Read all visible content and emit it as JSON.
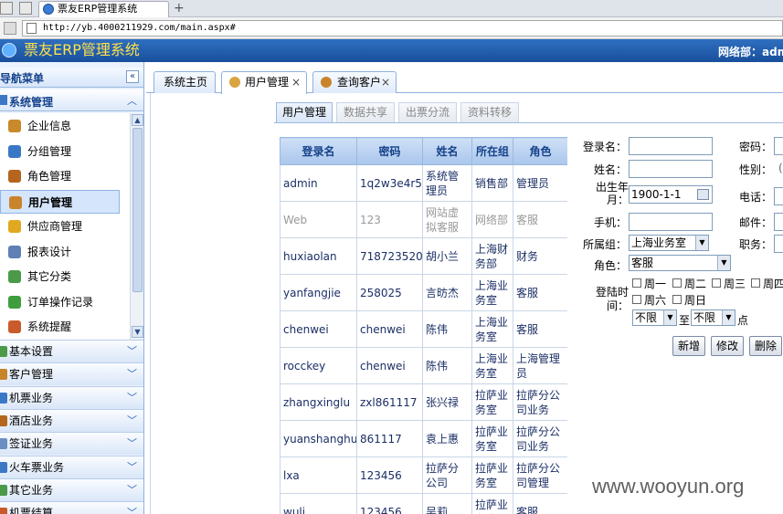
{
  "browser": {
    "tab_title": "票友ERP管理系统",
    "new_tab": "+",
    "url": "http://yb.4000211929.com/main.aspx#"
  },
  "header": {
    "app_title": "票友ERP管理系统",
    "user_info": "网络部：adm"
  },
  "sidebar": {
    "title": "导航菜单",
    "collapse": "«",
    "section_system": "系统管理",
    "items": [
      {
        "label": "企业信息",
        "icon": "building-icon",
        "color": "#c98a2b"
      },
      {
        "label": "分组管理",
        "icon": "org-chart-icon",
        "color": "#3a78c6"
      },
      {
        "label": "角色管理",
        "icon": "role-icon",
        "color": "#b5651d"
      },
      {
        "label": "用户管理",
        "icon": "users-icon",
        "color": "#c9842b"
      },
      {
        "label": "供应商管理",
        "icon": "shield-icon",
        "color": "#e0a91f"
      },
      {
        "label": "报表设计",
        "icon": "report-icon",
        "color": "#5f7fb5"
      },
      {
        "label": "其它分类",
        "icon": "category-icon",
        "color": "#4a9a4a"
      },
      {
        "label": "订单操作记录",
        "icon": "check-icon",
        "color": "#3e9e3e"
      },
      {
        "label": "系统提醒",
        "icon": "bell-icon",
        "color": "#c95b2b"
      }
    ],
    "active_index": 3,
    "sections": [
      {
        "label": "基本设置",
        "color": "#4a9a4a"
      },
      {
        "label": "客户管理",
        "color": "#c9842b"
      },
      {
        "label": "机票业务",
        "color": "#3a78c6"
      },
      {
        "label": "酒店业务",
        "color": "#b5651d"
      },
      {
        "label": "签证业务",
        "color": "#6a8fc2"
      },
      {
        "label": "火车票业务",
        "color": "#3a78c6"
      },
      {
        "label": "其它业务",
        "color": "#4a9a4a"
      },
      {
        "label": "机票结算",
        "color": "#c95b2b"
      }
    ]
  },
  "content_tabs": [
    {
      "label": "系统主页",
      "closable": false
    },
    {
      "label": "用户管理",
      "closable": true,
      "close": "×"
    },
    {
      "label": "查询客户",
      "closable": true,
      "close": "×"
    }
  ],
  "inner_tabs": [
    "用户管理",
    "数据共享",
    "出票分流",
    "资料转移"
  ],
  "table": {
    "headers": [
      "登录名",
      "密码",
      "姓名",
      "所在组",
      "角色"
    ],
    "rows": [
      {
        "login": "admin",
        "password": "1q2w3e4r5t",
        "name": "系统管理员",
        "group": "销售部",
        "role": "管理员",
        "disabled": false
      },
      {
        "login": "Web",
        "password": "123",
        "name": "网站虚拟客服",
        "group": "网络部",
        "role": "客服",
        "disabled": true
      },
      {
        "login": "huxiaolan",
        "password": "718723520",
        "name": "胡小兰",
        "group": "上海财务部",
        "role": "财务",
        "disabled": false
      },
      {
        "login": "yanfangjie",
        "password": "258025",
        "name": "言昉杰",
        "group": "上海业务室",
        "role": "客服",
        "disabled": false
      },
      {
        "login": "chenwei",
        "password": "chenwei",
        "name": "陈伟",
        "group": "上海业务室",
        "role": "客服",
        "disabled": false
      },
      {
        "login": "rocckey",
        "password": "chenwei",
        "name": "陈伟",
        "group": "上海业务室",
        "role": "上海管理员",
        "disabled": false
      },
      {
        "login": "zhangxinglu",
        "password": "zxl861117",
        "name": "张兴禄",
        "group": "拉萨业务室",
        "role": "拉萨分公司业务",
        "disabled": false
      },
      {
        "login": "yuanshanghui",
        "password": "861117",
        "name": "袁上惠",
        "group": "拉萨业务室",
        "role": "拉萨分公司业务",
        "disabled": false
      },
      {
        "login": "lxa",
        "password": "123456",
        "name": "拉萨分公司",
        "group": "拉萨业务室",
        "role": "拉萨分公司管理",
        "disabled": false
      },
      {
        "login": "wuli",
        "password": "123456",
        "name": "吴莉",
        "group": "拉萨业务室",
        "role": "客服",
        "disabled": false
      }
    ]
  },
  "form": {
    "login_label": "登录名：",
    "login_value": "",
    "name_label": "姓名：",
    "name_value": "",
    "birth_label": "出生年月：",
    "birth_value": "1900-1-1",
    "phone_label": "手机：",
    "phone_value": "",
    "group_label": "所属组：",
    "group_value": "上海业务室",
    "role_label": "角色：",
    "role_value": "客服",
    "login_time_label": "登陆时间：",
    "days": [
      "周一",
      "周二",
      "周三",
      "周四",
      "周六",
      "周日"
    ],
    "from_value": "不限",
    "to_label": "至",
    "to_value": "不限",
    "hour_suffix": "点",
    "password_label": "密码：",
    "gender_label": "性别：",
    "gender_value": "(",
    "tel_label": "电话：",
    "email_label": "邮件：",
    "position_label": "职务：",
    "btn_add": "新增",
    "btn_edit": "修改",
    "btn_delete": "删除"
  },
  "watermark": "www.wooyun.org"
}
